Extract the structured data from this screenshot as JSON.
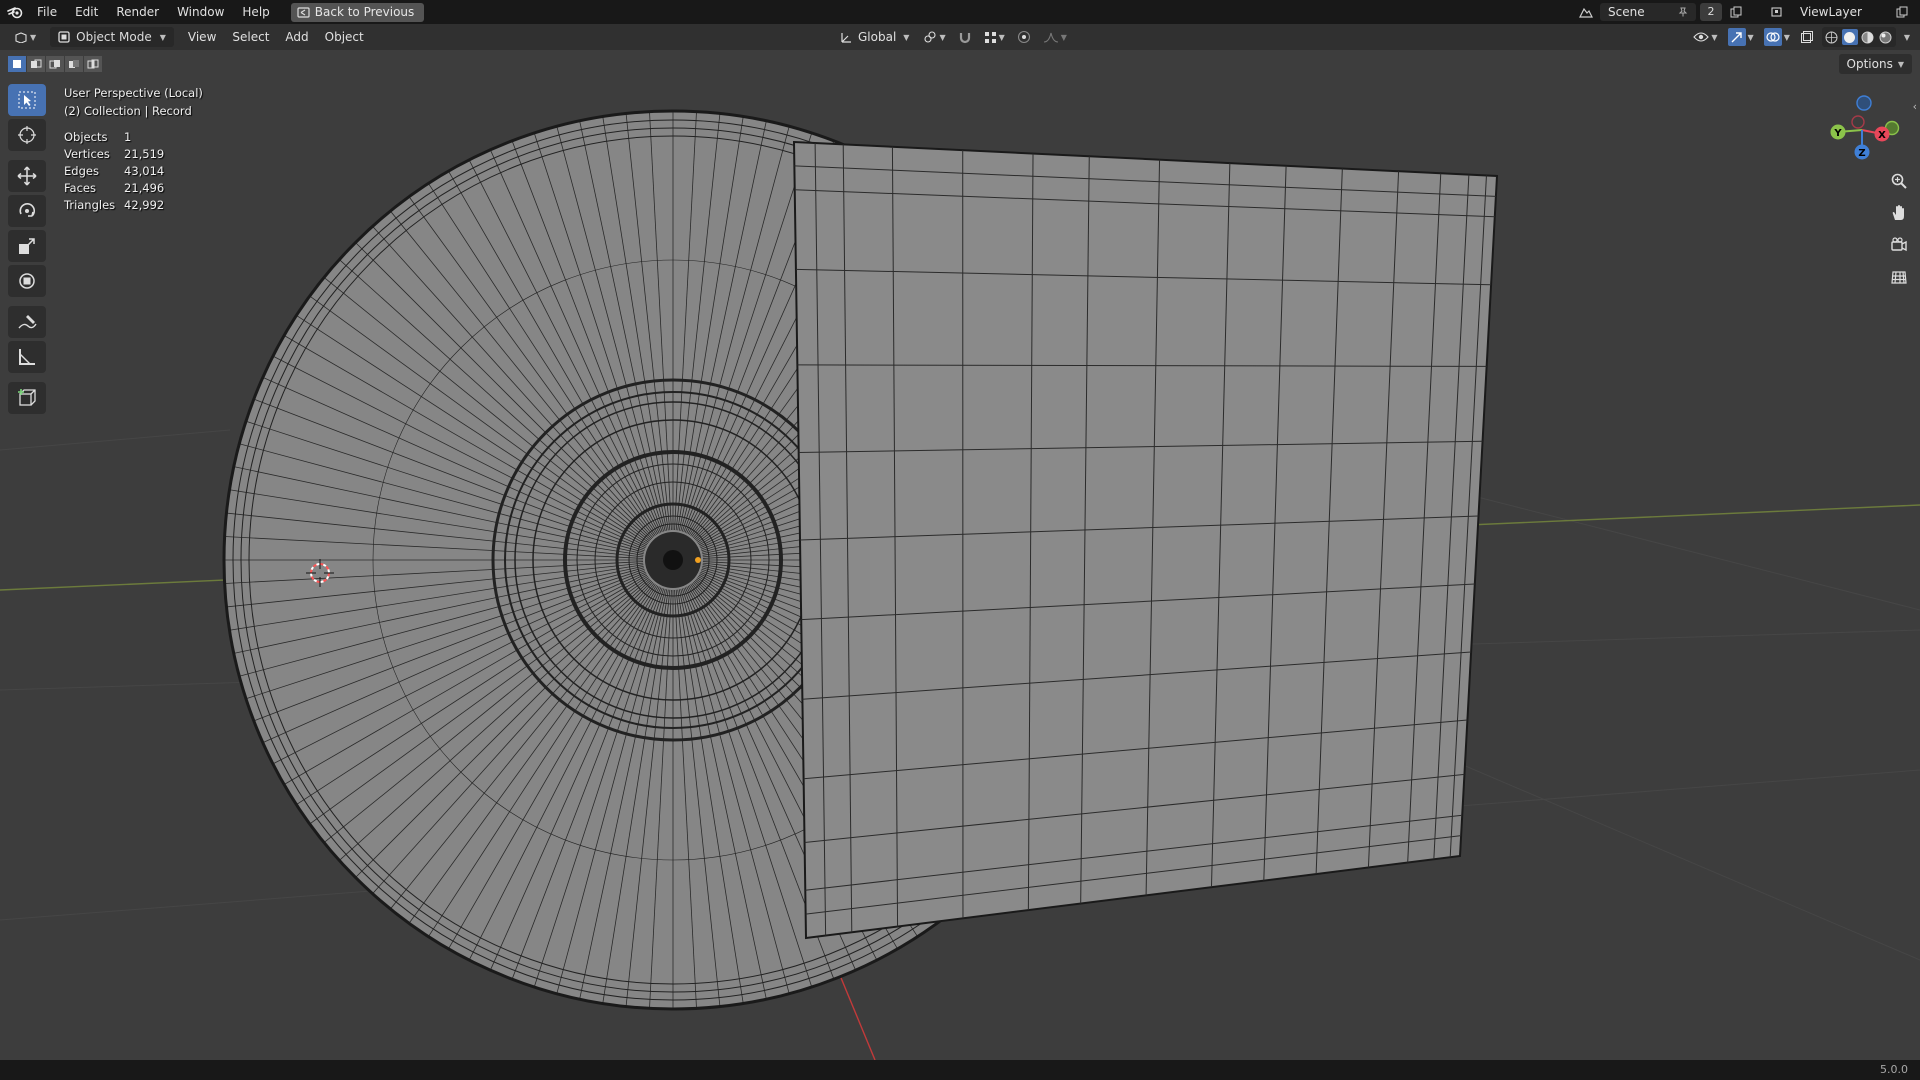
{
  "menu": {
    "items": [
      "File",
      "Edit",
      "Render",
      "Window",
      "Help"
    ],
    "back_button": "Back to Previous"
  },
  "topright": {
    "scene": "Scene",
    "scene_users": "2",
    "view_layer": "ViewLayer"
  },
  "header": {
    "mode": "Object Mode",
    "menus": [
      "View",
      "Select",
      "Add",
      "Object"
    ],
    "transform_orientation": "Global"
  },
  "viewport": {
    "perspective": "User Perspective (Local)",
    "collection": "(2) Collection | Record",
    "options": "Options",
    "stats": [
      {
        "label": "Objects",
        "value": "1"
      },
      {
        "label": "Vertices",
        "value": "21,519"
      },
      {
        "label": "Edges",
        "value": "43,014"
      },
      {
        "label": "Faces",
        "value": "21,496"
      },
      {
        "label": "Triangles",
        "value": "42,992"
      }
    ]
  },
  "gizmo": {
    "x": "X",
    "y": "Y",
    "z": "Z"
  },
  "statusbar": {
    "version": "5.0.0"
  },
  "colors": {
    "accent": "#4772b3",
    "axis_x": "#e8475a",
    "axis_y": "#8bc34a",
    "axis_z": "#3f7fd6"
  }
}
